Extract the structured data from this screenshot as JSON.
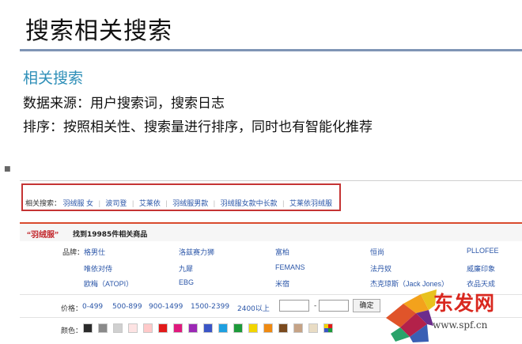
{
  "slide": {
    "title": "搜索相关搜索",
    "subheading": "相关搜索",
    "line1": "数据来源：用户搜索词，搜索日志",
    "line2": "排序：按照相关性、搜索量进行排序，同时也有智能化推荐",
    "marker": "■"
  },
  "screenshot": {
    "related": {
      "label": "相关搜索：",
      "links": [
        "羽绒服 女",
        "波司登",
        "艾莱依",
        "羽绒服男款",
        "羽绒服女款中长款",
        "艾莱依羽绒服"
      ],
      "separator": "|"
    },
    "results": {
      "query": "“羽绒服”",
      "count_text": "找到19985件相关商品"
    },
    "brands": {
      "label": "品牌：",
      "items": [
        "格男仕",
        "洛兹赛力狮",
        "富柏",
        "恒尚",
        "PLLOFEE",
        "唯依对侍",
        "九犀",
        "FEMANS",
        "法丹奴",
        "威廉印象",
        "欧梅（ATOPI）",
        "EBG",
        "米宿",
        "杰克琼斯（Jack Jones）",
        "衣品天成"
      ]
    },
    "price": {
      "label": "价格：",
      "ranges": [
        "0-499",
        "500-899",
        "900-1499",
        "1500-2399",
        "2400以上"
      ],
      "dash": "-",
      "confirm_label": "确定"
    },
    "colors": {
      "label": "颜色：",
      "swatches": [
        "#2b2b2b",
        "#8a8a8a",
        "#d0d0d0",
        "#fde3e3",
        "#ffc9c9",
        "#e21a1a",
        "#e0197d",
        "#9b28b5",
        "#3a55c6",
        "#1e9fe0",
        "#1d9a3a",
        "#f2d500",
        "#ef8a12",
        "#7a4a1e",
        "#c6a386",
        "#e9dcc4",
        "#multi"
      ]
    }
  },
  "watermark": {
    "text": "东发网",
    "url": "www.spf.cn"
  }
}
